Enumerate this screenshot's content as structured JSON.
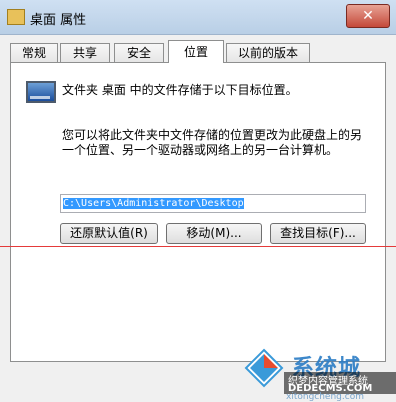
{
  "window": {
    "title": "桌面 属性",
    "close_glyph": "✕"
  },
  "tabs": [
    {
      "label": "常规"
    },
    {
      "label": "共享"
    },
    {
      "label": "安全"
    },
    {
      "label": "位置",
      "active": true
    },
    {
      "label": "以前的版本"
    }
  ],
  "location": {
    "icon": "folder-desktop-icon",
    "heading": "文件夹 桌面 中的文件存储于以下目标位置。",
    "description": "您可以将此文件夹中文件存储的位置更改为此硬盘上的另一个位置、另一个驱动器或网络上的另一台计算机。",
    "path": "C:\\Users\\Administrator\\Desktop"
  },
  "buttons": {
    "restore_default": "还原默认值(R)",
    "move": "移动(M)...",
    "find_target": "查找目标(F)..."
  },
  "watermark": {
    "brand": "系统城",
    "line1": "织梦内容管理系统",
    "line2": "DEDECMS.COM",
    "site": "xitongcheng.com",
    "colors": [
      "#e84c2f",
      "#3a9ad9",
      "#2a7cc5"
    ]
  }
}
